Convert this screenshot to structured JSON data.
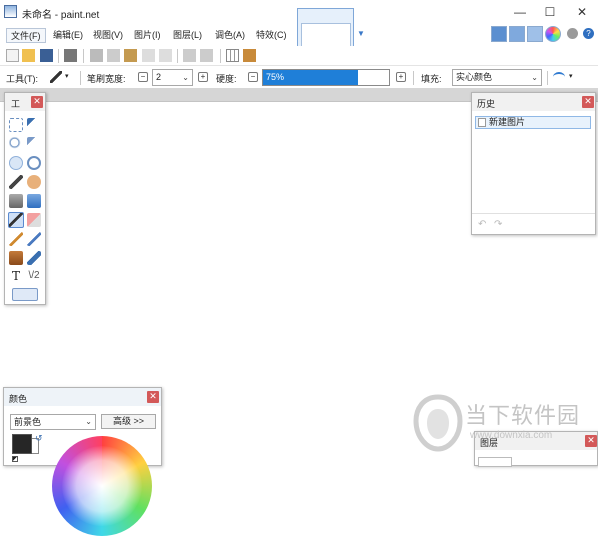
{
  "window": {
    "title": "未命名 - paint.net",
    "minimize": "—",
    "maximize": "☐",
    "close": "✕"
  },
  "menu": [
    "文件(F)",
    "编辑(E)",
    "视图(V)",
    "图片(I)",
    "图层(L)",
    "调色(A)",
    "特效(C)"
  ],
  "toolbar2": {
    "tool_label": "工具(T):",
    "brush_width_label": "笔刷宽度:",
    "brush_width_value": "2",
    "hardness_label": "硬度:",
    "hardness_value": "75%",
    "hardness_fraction": 0.75,
    "fill_label": "填充:",
    "fill_value": "实心颜色"
  },
  "tools_panel": {
    "title": "工"
  },
  "history_panel": {
    "title": "历史",
    "items": [
      "新建图片"
    ]
  },
  "colors_panel": {
    "title": "颜色",
    "mode_value": "前景色",
    "advanced_button": "高级 >>"
  },
  "layers_panel": {
    "title": "图层"
  },
  "watermark": {
    "name": "当下软件园",
    "url": "www.downxia.com"
  },
  "colors": {
    "accent": "#1f7fd8",
    "close": "#d35959"
  }
}
